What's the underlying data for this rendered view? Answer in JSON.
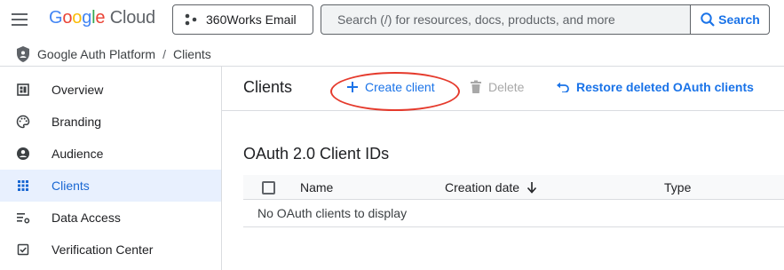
{
  "header": {
    "logo_google": [
      "G",
      "o",
      "o",
      "g",
      "l",
      "e"
    ],
    "logo_cloud": "Cloud",
    "project_name": "360Works Email",
    "search_placeholder": "Search (/) for resources, docs, products, and more",
    "search_button": "Search"
  },
  "breadcrumb": {
    "items": [
      "Google Auth Platform",
      "Clients"
    ],
    "separator": "/"
  },
  "sidebar": {
    "items": [
      {
        "label": "Overview",
        "icon": "dashboard-icon",
        "active": false
      },
      {
        "label": "Branding",
        "icon": "palette-icon",
        "active": false
      },
      {
        "label": "Audience",
        "icon": "person-circle-icon",
        "active": false
      },
      {
        "label": "Clients",
        "icon": "grid-icon",
        "active": true
      },
      {
        "label": "Data Access",
        "icon": "data-access-icon",
        "active": false
      },
      {
        "label": "Verification Center",
        "icon": "verified-checkbox-icon",
        "active": false
      }
    ]
  },
  "toolbar": {
    "title": "Clients",
    "create_label": "Create client",
    "delete_label": "Delete",
    "restore_label": "Restore deleted OAuth clients"
  },
  "section": {
    "title": "OAuth 2.0 Client IDs",
    "columns": [
      "Name",
      "Creation date",
      "Type"
    ],
    "empty_message": "No OAuth clients to display"
  },
  "colors": {
    "accent": "#1a73e8",
    "active_bg": "#e8f0fe",
    "annotation": "#e53a2c",
    "disabled": "#a8a8a8"
  }
}
